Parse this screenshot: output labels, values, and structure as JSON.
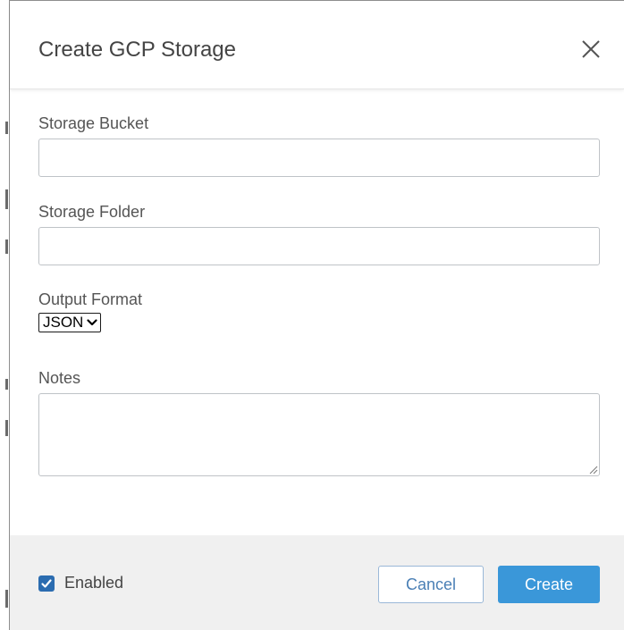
{
  "dialog": {
    "title": "Create GCP Storage",
    "close_icon": "close-icon"
  },
  "form": {
    "storage_bucket": {
      "label": "Storage Bucket",
      "value": "",
      "placeholder": ""
    },
    "storage_folder": {
      "label": "Storage Folder",
      "value": "",
      "placeholder": ""
    },
    "output_format": {
      "label": "Output Format",
      "selected": "JSON",
      "chevron_icon": "chevron-down-icon"
    },
    "notes": {
      "label": "Notes",
      "value": "",
      "placeholder": ""
    }
  },
  "footer": {
    "enabled_label": "Enabled",
    "enabled_checked": true,
    "cancel_label": "Cancel",
    "create_label": "Create"
  },
  "colors": {
    "primary": "#3a97d9",
    "checkbox": "#2b6cb0",
    "footer_bg": "#f0f0f0"
  }
}
